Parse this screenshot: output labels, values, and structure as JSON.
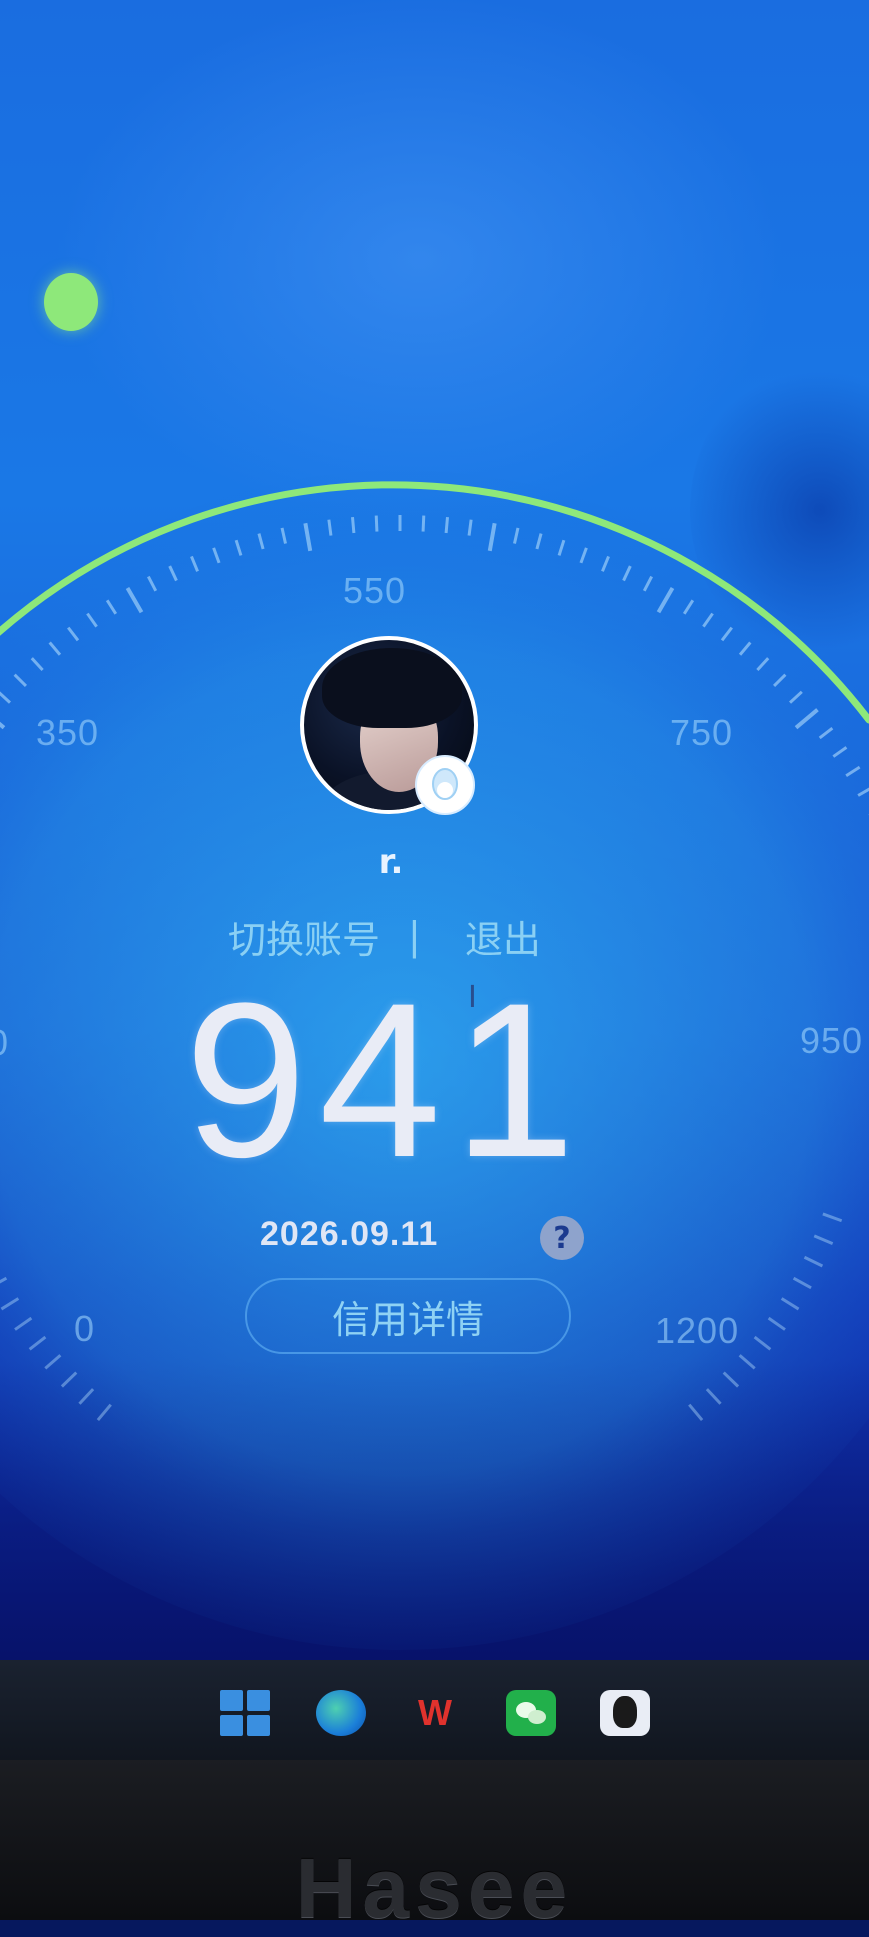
{
  "gauge": {
    "labels": [
      "0",
      "350",
      "550",
      "750",
      "950",
      "1200"
    ],
    "partial_left_label": "0"
  },
  "user": {
    "name": "r.",
    "switch_account": "切换账号",
    "separator": "|",
    "logout": "退出"
  },
  "score": {
    "value": "941",
    "date": "2026.09.11",
    "help": "?",
    "details_button": "信用详情"
  },
  "taskbar": {
    "icons": [
      "windows-start-icon",
      "edge-browser-icon",
      "wps-office-icon",
      "wechat-icon",
      "qq-icon"
    ],
    "wps_glyph": "W"
  },
  "device": {
    "brand": "Hasee"
  },
  "colors": {
    "accent_green": "#8ee87a",
    "score_text": "#e9ecf6",
    "link_text": "#96d7f5"
  }
}
